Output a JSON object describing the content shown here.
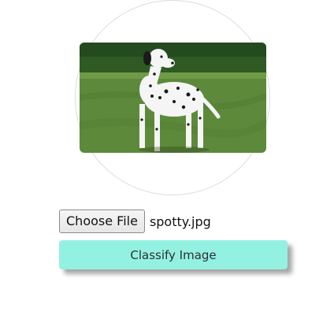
{
  "image_preview": {
    "subject_icon": "dalmatian-photo",
    "colors": {
      "grass": "#5c8a3a",
      "trees": "#2f5a24",
      "dog_white": "#f5f5f5",
      "dog_spots": "#1a1a1a"
    }
  },
  "file_input": {
    "button_label": "Choose File",
    "selected_file": "spotty.jpg"
  },
  "actions": {
    "classify_label": "Classify Image",
    "accent": "#93f1e2"
  }
}
